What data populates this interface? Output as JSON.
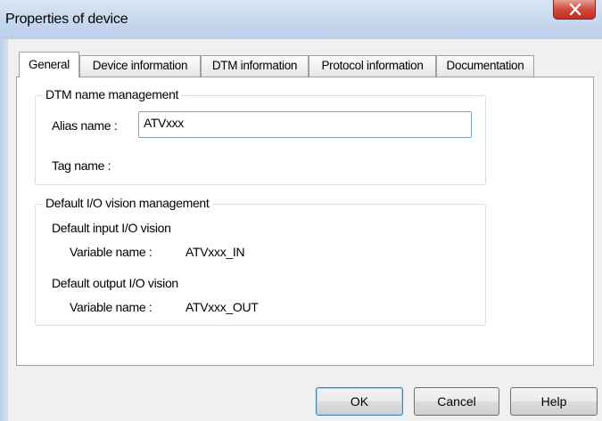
{
  "window": {
    "title": "Properties of device",
    "close_glyph": "X"
  },
  "tabs": [
    {
      "label": "General",
      "active": true
    },
    {
      "label": "Device information",
      "active": false
    },
    {
      "label": "DTM information",
      "active": false
    },
    {
      "label": "Protocol information",
      "active": false
    },
    {
      "label": "Documentation",
      "active": false
    }
  ],
  "dtm_name_group": {
    "title": "DTM name management",
    "alias_label": "Alias name :",
    "alias_value": "ATVxxx",
    "tag_label": "Tag name :"
  },
  "io_group": {
    "title": "Default I/O vision management",
    "input_heading": "Default input I/O vision",
    "input_var_label": "Variable name :",
    "input_var_value": "ATVxxx_IN",
    "output_heading": "Default output I/O vision",
    "output_var_label": "Variable name :",
    "output_var_value": "ATVxxx_OUT"
  },
  "buttons": {
    "ok": "OK",
    "cancel": "Cancel",
    "help": "Help"
  },
  "colors": {
    "titlebar": "#c8d9ee",
    "close_button": "#d2483a",
    "dialog_background": "#f0f0f0",
    "default_button_border": "#3c7fb1"
  }
}
